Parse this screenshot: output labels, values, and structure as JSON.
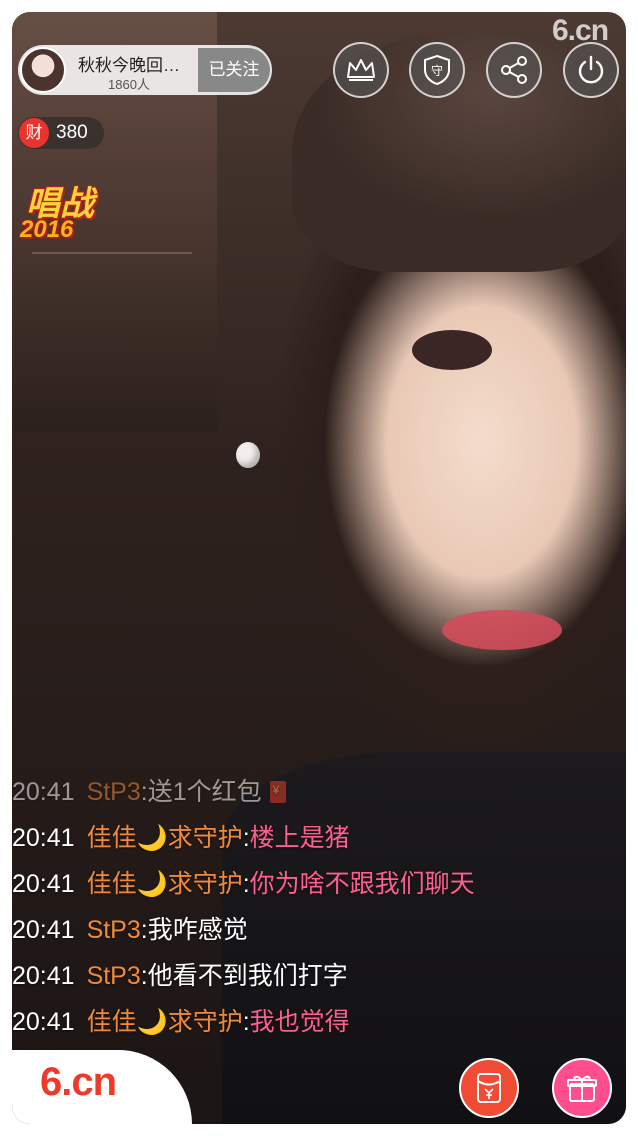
{
  "anchor": {
    "name": "秋秋今晚回…",
    "viewers": "1860人",
    "follow_label": "已关注"
  },
  "toolbar": {
    "icons": [
      "crown-icon",
      "guard-icon",
      "share-icon",
      "power-icon"
    ],
    "guard_label": "守"
  },
  "watermark_top": "6.cn",
  "fortune": {
    "icon_label": "财",
    "value": "380"
  },
  "event_badge": {
    "title": "唱战",
    "year": "2016"
  },
  "chat": {
    "messages": [
      {
        "time": "20:41",
        "user": "StP3",
        "sep": ":",
        "content": "送1个红包",
        "content_color": "white",
        "has_redpacket": true
      },
      {
        "time": "20:41",
        "user": "佳佳🌙求守护",
        "sep": ":",
        "content": "楼上是猪",
        "content_color": "pink"
      },
      {
        "time": "20:41",
        "user": "佳佳🌙求守护",
        "sep": ":",
        "content": "你为啥不跟我们聊天",
        "content_color": "pink"
      },
      {
        "time": "20:41",
        "user": "StP3",
        "sep": ":",
        "content": "我咋感觉",
        "content_color": "white"
      },
      {
        "time": "20:41",
        "user": "StP3",
        "sep": ":",
        "content": "他看不到我们打字",
        "content_color": "white"
      },
      {
        "time": "20:41",
        "user": "佳佳🌙求守护",
        "sep": ":",
        "content": "我也觉得",
        "content_color": "pink"
      }
    ]
  },
  "bottom": {
    "logo": "6.cn",
    "buttons": [
      "red-packet-icon",
      "gift-icon"
    ]
  },
  "colors": {
    "username": "#f08a38",
    "pink_message": "#ff5e8e",
    "brand_red": "#ee3a2b",
    "gift_pink": "#ff4e8c"
  }
}
